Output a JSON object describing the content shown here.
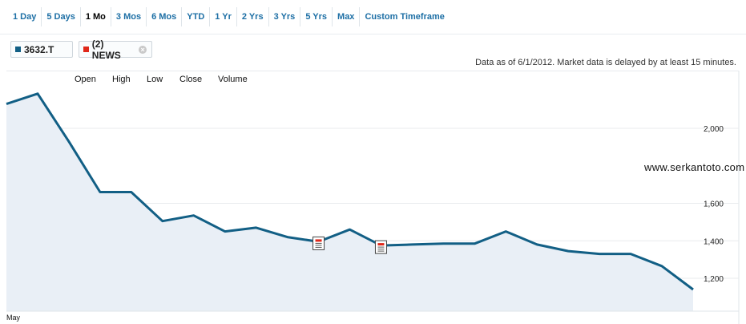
{
  "tabs": [
    "1 Day",
    "5 Days",
    "1 Mo",
    "3 Mos",
    "6 Mos",
    "YTD",
    "1 Yr",
    "2 Yrs",
    "3 Yrs",
    "5 Yrs",
    "Max",
    "Custom Timeframe"
  ],
  "active_tab": "1 Mo",
  "legend": {
    "symbol": "3632.T",
    "symbol_color": "#125f85",
    "news": "(2) NEWS",
    "news_color": "#e0281a",
    "close_icon": "close-icon"
  },
  "as_of": "Data as of 6/1/2012. Market data is delayed by at least 15 minutes.",
  "ohlc": {
    "open": "Open",
    "high": "High",
    "low": "Low",
    "close": "Close",
    "volume": "Volume"
  },
  "watermark": "www.serkantoto.com",
  "colors": {
    "line": "#125f85",
    "fill": "#e9eff6",
    "grid": "#e8ebee",
    "accent": "#1d6fa5"
  },
  "chart_data": {
    "type": "area",
    "x_label": "May",
    "yticks": [
      "2,000",
      "1,600",
      "1,400",
      "1,200"
    ],
    "ytick_values": [
      2000,
      1600,
      1400,
      1200
    ],
    "grid": true,
    "values": [
      2130,
      2185,
      1930,
      1660,
      1660,
      1505,
      1535,
      1450,
      1470,
      1420,
      1395,
      1460,
      1375,
      1380,
      1385,
      1385,
      1450,
      1380,
      1345,
      1330,
      1330,
      1265,
      1140
    ],
    "news_markers": [
      10,
      12
    ]
  }
}
